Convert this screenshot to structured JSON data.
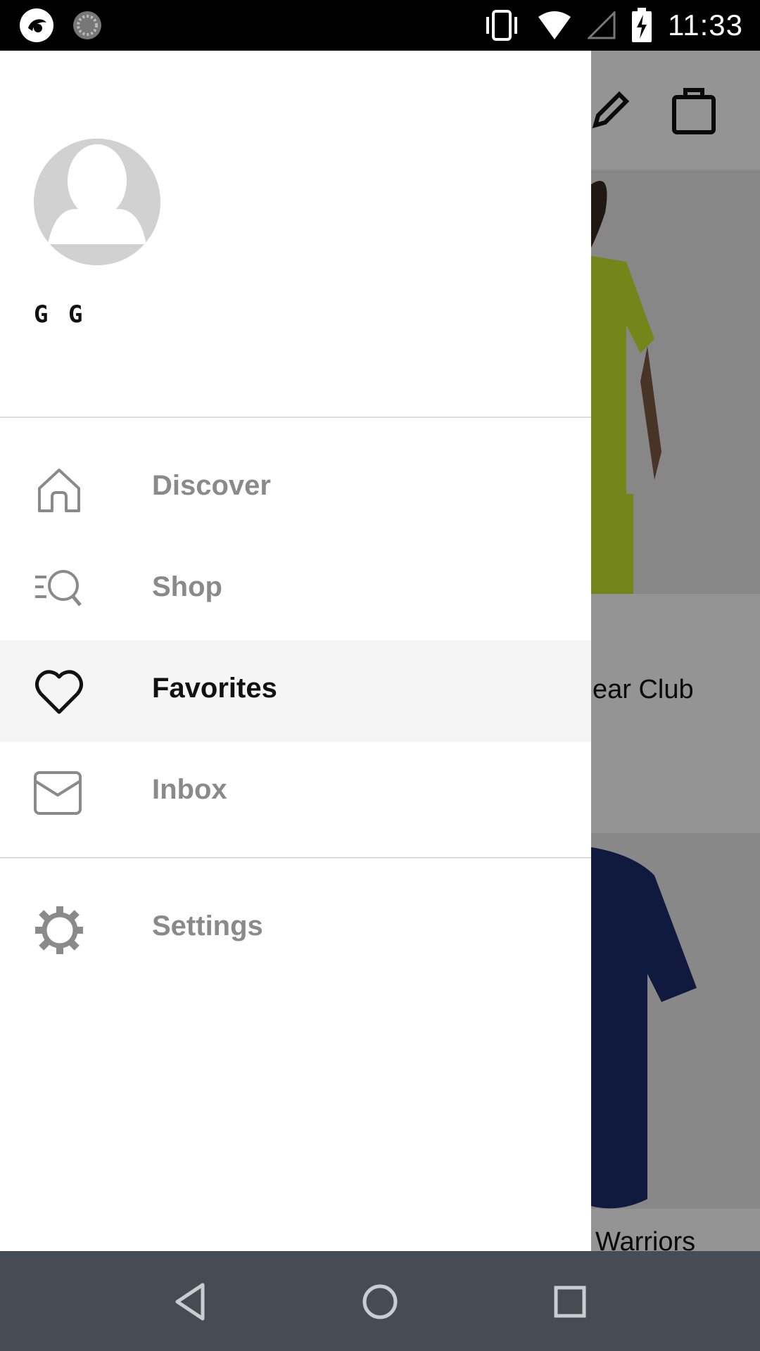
{
  "status_bar": {
    "time": "11:33",
    "icons": [
      "app-logo-icon",
      "sync-icon",
      "vibrate-icon",
      "wifi-icon",
      "signal-icon",
      "battery-charging-icon"
    ]
  },
  "background": {
    "caption_1": "ear Club",
    "caption_2": "Warriors",
    "toolbar_icons": [
      "pencil-icon",
      "shopping-bag-icon"
    ]
  },
  "drawer": {
    "user_name": "G G",
    "items": [
      {
        "label": "Discover",
        "icon": "home-icon",
        "active": false
      },
      {
        "label": "Shop",
        "icon": "search-list-icon",
        "active": false
      },
      {
        "label": "Favorites",
        "icon": "heart-icon",
        "active": true
      },
      {
        "label": "Inbox",
        "icon": "mail-icon",
        "active": false
      },
      {
        "label": "Settings",
        "icon": "gear-icon",
        "active": false
      }
    ]
  },
  "nav_bar": {
    "buttons": [
      "back-icon",
      "home-circle-icon",
      "recents-icon"
    ]
  }
}
